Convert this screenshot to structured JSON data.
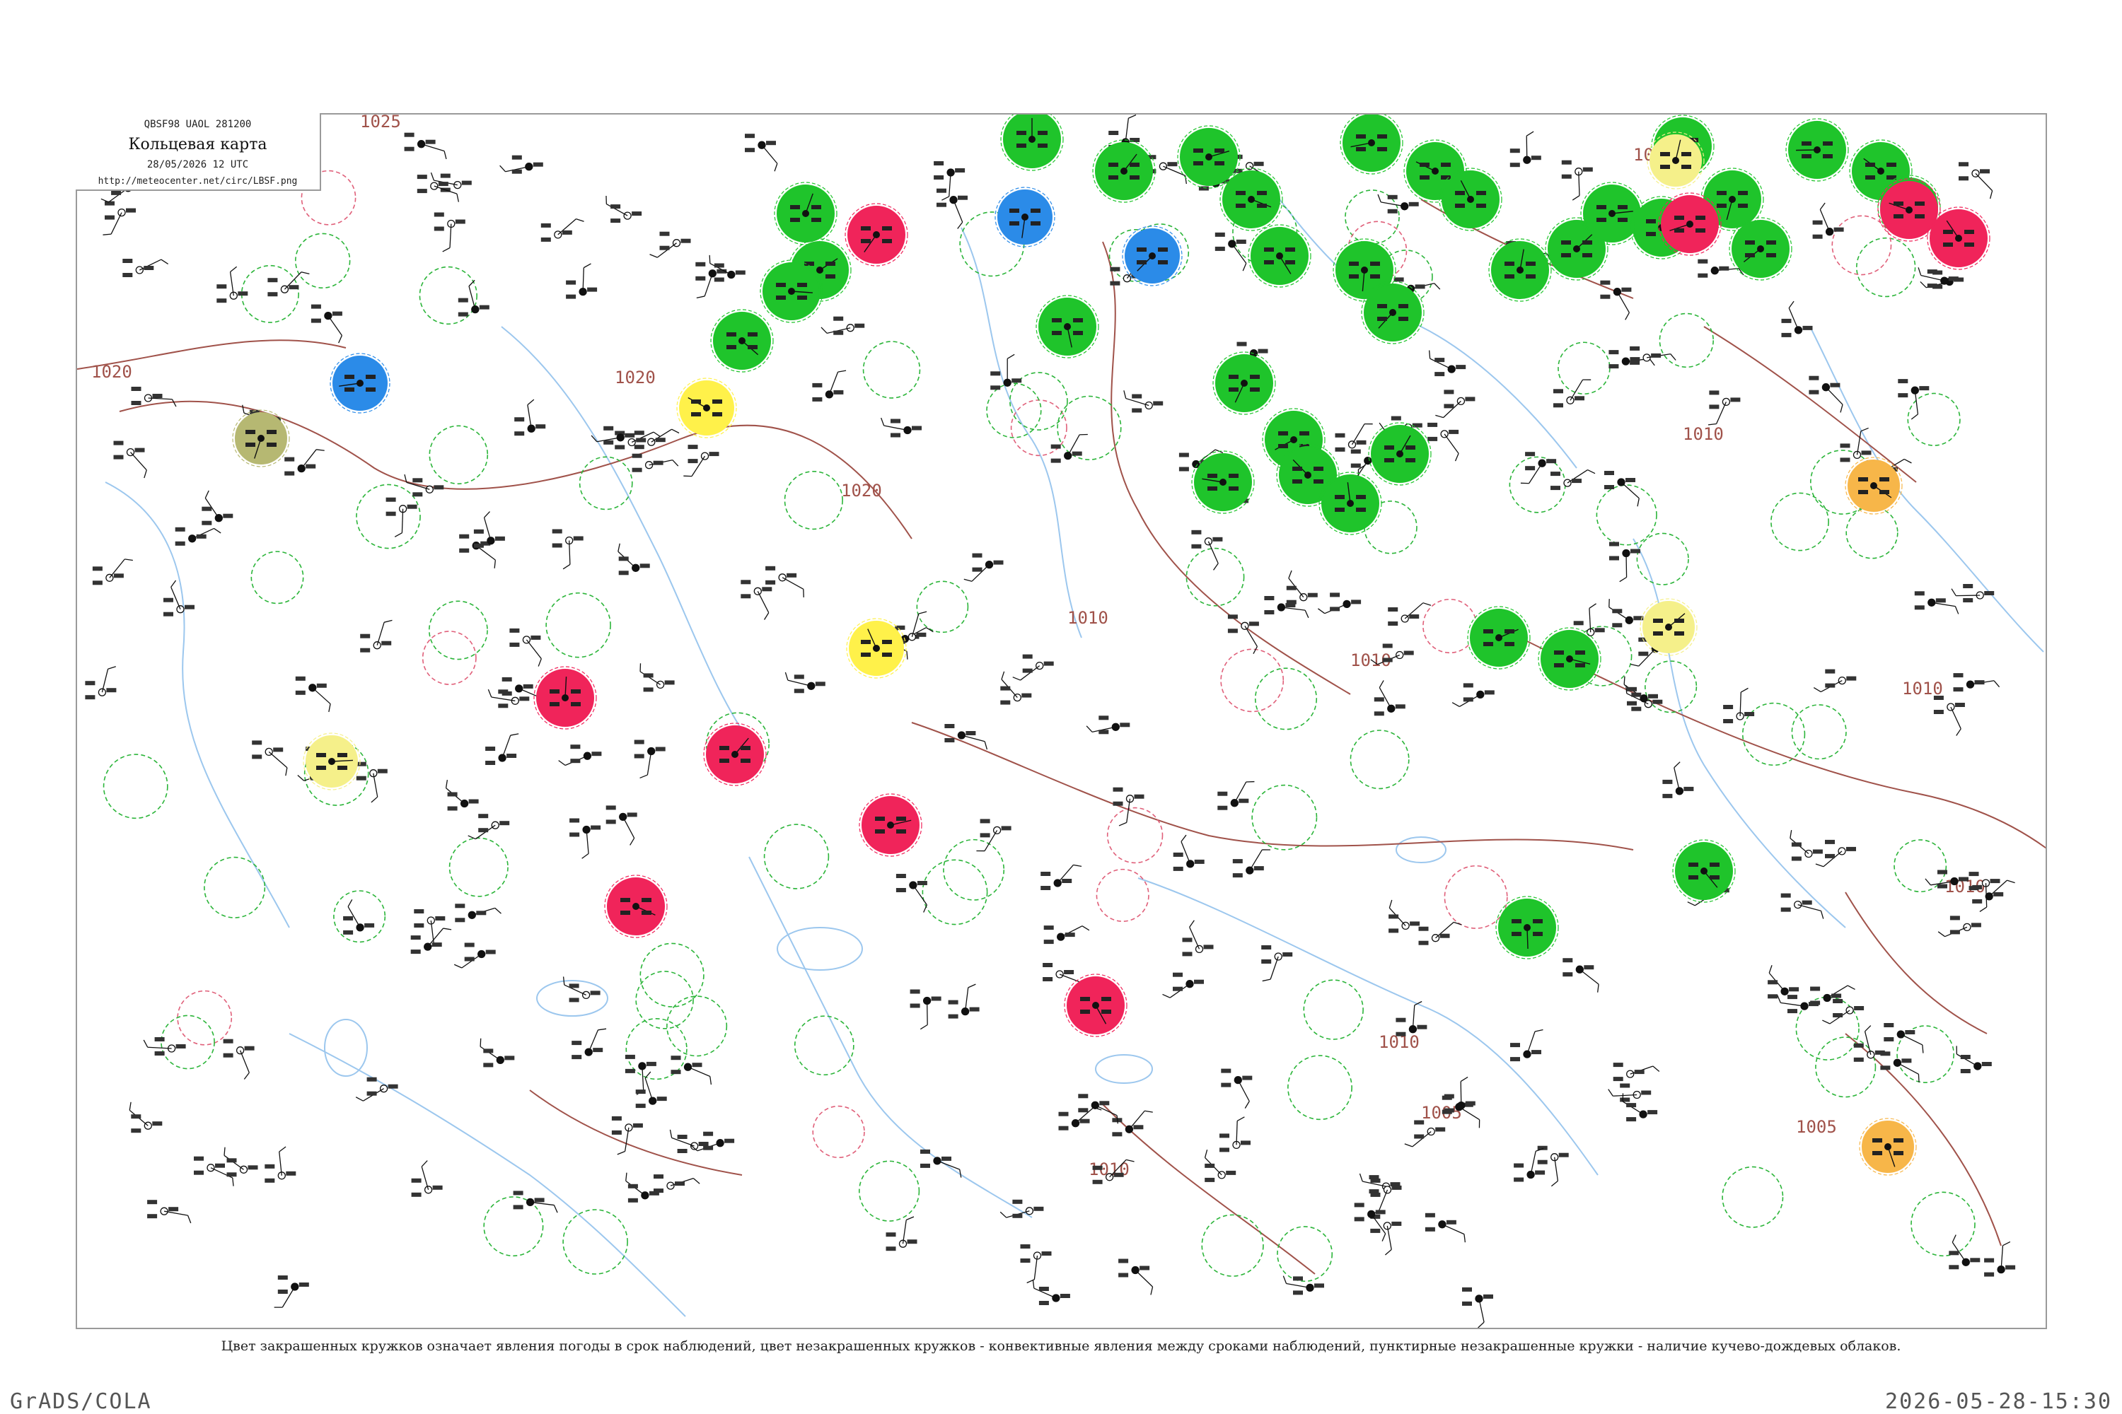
{
  "header": {
    "code": "QBSF98  UAOL  281200",
    "title": "Кольцевая карта",
    "date": "28/05/2026 12 UTC",
    "url": "http://meteocenter.net/circ/LBSF.png"
  },
  "caption": "Цвет закрашенных кружков означает явления погоды в срок наблюдений, цвет незакрашенных кружков - конвективные явления между сроками наблюдений, пунктирные незакрашенные кружки - наличие кучево-дождевых облаков.",
  "footer": {
    "left": "GrADS/COLA",
    "right": "2026-05-28-15:30"
  },
  "colors": {
    "green": "#1fc42b",
    "red": "#f0245a",
    "blue": "#2b8be8",
    "yellow": "#fff14a",
    "pale_yellow": "#f5f08a",
    "orange": "#f7b649",
    "olive": "#b6b872",
    "isobar": "#a0524a",
    "water": "#9cc7ee"
  },
  "isobar_labels": [
    "1025",
    "1020",
    "1020",
    "1020",
    "1010",
    "1010",
    "1010",
    "1010",
    "1005",
    "1005",
    "1010",
    "1000",
    "1010",
    "1010"
  ],
  "filled_stations": [
    {
      "color": "green"
    },
    {
      "color": "green"
    },
    {
      "color": "green"
    },
    {
      "color": "green"
    },
    {
      "color": "green"
    },
    {
      "color": "green"
    },
    {
      "color": "green"
    },
    {
      "color": "green"
    },
    {
      "color": "green"
    },
    {
      "color": "green"
    },
    {
      "color": "green"
    },
    {
      "color": "green"
    },
    {
      "color": "green"
    },
    {
      "color": "green"
    },
    {
      "color": "green"
    },
    {
      "color": "green"
    },
    {
      "color": "green"
    },
    {
      "color": "green"
    },
    {
      "color": "green"
    },
    {
      "color": "green"
    },
    {
      "color": "green"
    },
    {
      "color": "green"
    },
    {
      "color": "green"
    },
    {
      "color": "green"
    },
    {
      "color": "green"
    },
    {
      "color": "green"
    },
    {
      "color": "green"
    },
    {
      "color": "green"
    },
    {
      "color": "green"
    },
    {
      "color": "green"
    },
    {
      "color": "green"
    },
    {
      "color": "green"
    },
    {
      "color": "green"
    },
    {
      "color": "green"
    },
    {
      "color": "green"
    },
    {
      "color": "red"
    },
    {
      "color": "red"
    },
    {
      "color": "red"
    },
    {
      "color": "red"
    },
    {
      "color": "red"
    },
    {
      "color": "red"
    },
    {
      "color": "red"
    },
    {
      "color": "red"
    },
    {
      "color": "red"
    },
    {
      "color": "blue"
    },
    {
      "color": "blue"
    },
    {
      "color": "blue"
    },
    {
      "color": "yellow"
    },
    {
      "color": "yellow"
    },
    {
      "color": "pale_yellow"
    },
    {
      "color": "pale_yellow"
    },
    {
      "color": "pale_yellow"
    },
    {
      "color": "orange"
    },
    {
      "color": "orange"
    },
    {
      "color": "olive"
    }
  ]
}
